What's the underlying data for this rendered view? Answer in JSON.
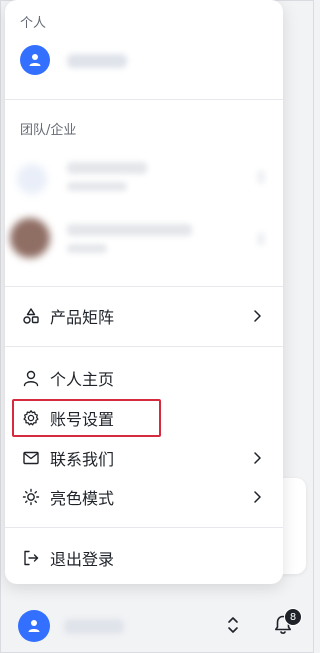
{
  "personal": {
    "section_label": "个人"
  },
  "team": {
    "section_label": "团队/企业"
  },
  "menu": {
    "product_matrix": "产品矩阵",
    "profile": "个人主页",
    "account_settings": "账号设置",
    "contact_us": "联系我们",
    "light_mode": "亮色模式",
    "logout": "退出登录"
  },
  "notifications": {
    "count": "8"
  },
  "colors": {
    "accent": "#3370ff",
    "highlight": "#d62b3f"
  }
}
